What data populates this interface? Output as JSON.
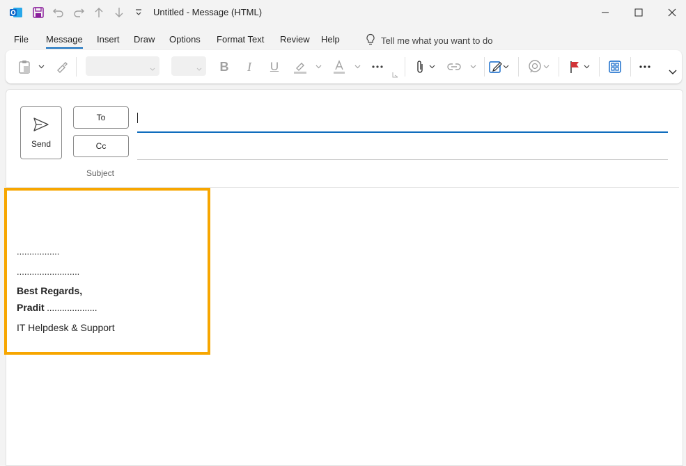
{
  "title_bar": {
    "title": "Untitled  -  Message (HTML)"
  },
  "menu": {
    "tabs": [
      "File",
      "Message",
      "Insert",
      "Draw",
      "Options",
      "Format Text",
      "Review",
      "Help"
    ],
    "active_tab": "Message",
    "tell_me": "Tell me what you want to do"
  },
  "ribbon": {
    "font_name": "",
    "font_size": ""
  },
  "compose": {
    "send_label": "Send",
    "to_label": "To",
    "cc_label": "Cc",
    "subject_label": "Subject",
    "to_value": "",
    "cc_value": "",
    "subject_value": ""
  },
  "body": {
    "line1": ".................",
    "line2": ".........................",
    "regards": "Best Regards,",
    "name": "Pradit",
    "name_dots": " ....................",
    "dept": "IT Helpdesk & Support"
  },
  "colors": {
    "accent": "#0f6cbd",
    "highlight_box": "#f7a600",
    "outlook_blue": "#0a64c8",
    "save_purple": "#8b1f9c",
    "flag_red": "#d13438"
  }
}
